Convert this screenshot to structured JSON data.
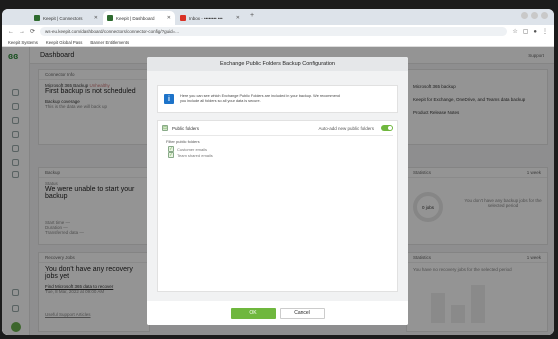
{
  "browser": {
    "tabs": [
      {
        "label": "Keepit | Connectors",
        "active": false
      },
      {
        "label": "Keepit | Dashboard",
        "active": true
      },
      {
        "label": "Inbox - •••••••• •••",
        "active": false
      }
    ],
    "tab_plus": "+",
    "url": "ws-eu.keepit.com/dashboard/connectors/connector-config/?guid=...",
    "bookmarks": [
      "Keepit Systems",
      "Keepit Global Pass",
      "Banner Entitlements"
    ]
  },
  "app": {
    "page_title": "Dashboard",
    "support_label": "Support",
    "connector_card": {
      "header": "Connector Info",
      "kind": "Microsoft 365 Backup",
      "tag": "Unhealthy",
      "status": "First backup is not scheduled",
      "sub_title": "Backup coverage",
      "sub_text": "This is the data we will back up"
    },
    "backup_card": {
      "header": "Backup",
      "status_label": "Status",
      "status": "We were unable to start your backup",
      "time_label": "Start time —",
      "duration_label": "Duration —",
      "transferred_label": "Transferred data —"
    },
    "recovery_card": {
      "header": "Recovery Jobs",
      "status": "You don't have any recovery jobs yet",
      "link": "Find Microsoft 365 data to recover",
      "date": "Tue, 8 Mar, 2022 at 09:00 AM",
      "footer_link": "Useful Support Articles"
    },
    "news_card": {
      "header": "",
      "items": [
        "Microsoft 365 backup",
        "Keepit for Exchange, OneDrive, and Teams data backup",
        "Product Release Notes"
      ]
    },
    "stats_card": {
      "header": "Statistics",
      "period": "1 week",
      "donut_label": "0 jobs",
      "empty_text": "You don't have any backup jobs for the selected period"
    },
    "recovery_stats_card": {
      "header": "Statistics",
      "period": "1 week",
      "empty_text": "You have no recovery jobs for the selected period"
    }
  },
  "modal": {
    "title": "Exchange Public Folders Backup Configuration",
    "info_icon": "info-icon",
    "info_line1": "Here you can see which Exchange Public Folders are included in your backup. We recommend",
    "info_line2": "you include all folders so all your data is secure.",
    "public_folders_label": "Public folders",
    "auto_add_label": "Auto-add new public folders",
    "auto_add_on": true,
    "filter_label": "Filter public folders",
    "folders": [
      "Customer emails",
      "Team shared emails"
    ],
    "ok_label": "OK",
    "cancel_label": "Cancel"
  },
  "colors": {
    "accent": "#6fb73e",
    "brand": "#2e8b3a",
    "info": "#1d73c9"
  }
}
